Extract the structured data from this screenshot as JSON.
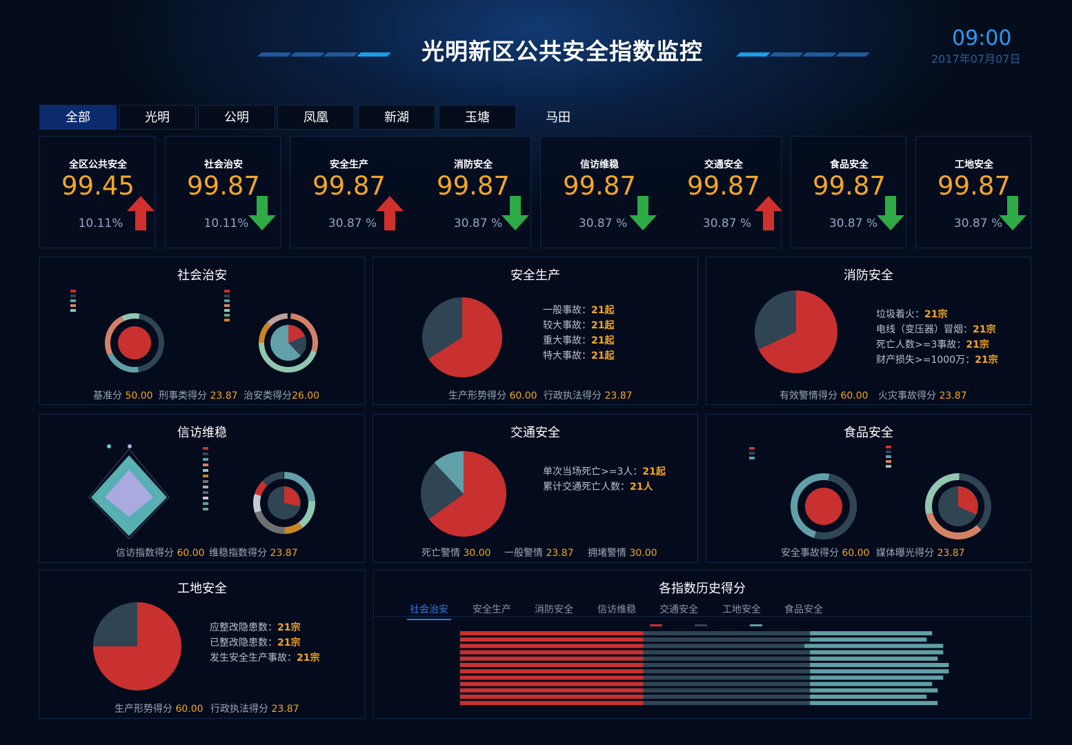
{
  "header": {
    "title": "光明新区公共安全指数监控",
    "time": "09:00",
    "date": "2017年07月07日"
  },
  "tabs": [
    "全部",
    "光明",
    "公明",
    "凤凰",
    "新湖",
    "玉塘",
    "马田"
  ],
  "kpis": [
    {
      "label": "全区公共安全",
      "value": "99.45",
      "pct": "10.11%",
      "trend": "up"
    },
    {
      "label": "社会治安",
      "value": "99.87",
      "pct": "10.11%",
      "trend": "down"
    },
    {
      "label": "安全生产",
      "value": "99.87",
      "pct": "30.87 %",
      "trend": "up"
    },
    {
      "label": "消防安全",
      "value": "99.87",
      "pct": "30.87 %",
      "trend": "down"
    },
    {
      "label": "信访维稳",
      "value": "99.87",
      "pct": "30.87 %",
      "trend": "down"
    },
    {
      "label": "交通安全",
      "value": "99.87",
      "pct": "30.87 %",
      "trend": "up"
    },
    {
      "label": "食品安全",
      "value": "99.87",
      "pct": "30.87 %",
      "trend": "down"
    },
    {
      "label": "工地安全",
      "value": "99.87",
      "pct": "30.87 %",
      "trend": "down"
    }
  ],
  "colors": {
    "red": "#c8312f",
    "slate": "#2f4554",
    "teal": "#61a0a8",
    "orange": "#d48265",
    "green": "#91c7ae",
    "gold": "#ca8622",
    "kpi_value": "#f5a623",
    "up": "#d0312d",
    "down": "#2eaa46"
  },
  "panels": {
    "shehui": {
      "title": "社会治安",
      "stats": [
        {
          "label": "基准分",
          "value": "50.00"
        },
        {
          "label": "刑事类得分",
          "value": "23.87"
        },
        {
          "label": "治安类得分",
          "value": "26.00"
        }
      ]
    },
    "anquan": {
      "title": "安全生产",
      "lines": [
        {
          "label": "一般事故：",
          "value": "21起"
        },
        {
          "label": "较大事故：",
          "value": "21起"
        },
        {
          "label": "重大事故：",
          "value": "21起"
        },
        {
          "label": "特大事故：",
          "value": "21起"
        }
      ],
      "stats": [
        {
          "label": "生产形势得分",
          "value": "60.00"
        },
        {
          "label": "行政执法得分",
          "value": "23.87"
        }
      ]
    },
    "xiaofang": {
      "title": "消防安全",
      "lines": [
        {
          "label": "垃圾着火：",
          "value": "21宗"
        },
        {
          "label": "电线（变压器）冒烟：",
          "value": "21宗"
        },
        {
          "label": "死亡人数>=3事故：",
          "value": "21宗"
        },
        {
          "label": "财产损失>=1000万：",
          "value": "21宗"
        }
      ],
      "stats": [
        {
          "label": "有效警情得分",
          "value": "60.00"
        },
        {
          "label": "火灾事故得分",
          "value": "23.87"
        }
      ]
    },
    "xinfang": {
      "title": "信访维稳",
      "stats": [
        {
          "label": "信访指数得分",
          "value": "60.00"
        },
        {
          "label": "维稳指数得分",
          "value": "23.87"
        }
      ]
    },
    "jiaotong": {
      "title": "交通安全",
      "lines": [
        {
          "label": "单次当场死亡>=3人：",
          "value": "21起"
        },
        {
          "label": "累计交通死亡人数：",
          "value": "21人"
        }
      ],
      "stats": [
        {
          "label": "死亡警情",
          "value": "30.00"
        },
        {
          "label": "一般警情",
          "value": "23.87"
        },
        {
          "label": "拥堵警情",
          "value": "30.00"
        }
      ]
    },
    "shipin": {
      "title": "食品安全",
      "stats": [
        {
          "label": "安全事故得分",
          "value": "60.00"
        },
        {
          "label": "媒体曝光得分",
          "value": "23.87"
        }
      ]
    },
    "gongdi": {
      "title": "工地安全",
      "lines": [
        {
          "label": "应整改隐患数：",
          "value": "21宗"
        },
        {
          "label": "已整改隐患数：",
          "value": "21宗"
        },
        {
          "label": "发生安全生产事故：",
          "value": "21宗"
        }
      ],
      "stats": [
        {
          "label": "生产形势得分",
          "value": "60.00"
        },
        {
          "label": "行政执法得分",
          "value": "23.87"
        }
      ]
    },
    "history": {
      "title": "各指数历史得分",
      "tabs": [
        "社会治安",
        "安全生产",
        "消防安全",
        "信访维稳",
        "交通安全",
        "工地安全",
        "食品安全"
      ]
    }
  },
  "chart_data": [
    {
      "type": "pie",
      "panel": "安全生产",
      "slices": [
        {
          "value": 66
        },
        {
          "value": 34
        }
      ]
    },
    {
      "type": "pie",
      "panel": "消防安全",
      "slices": [
        {
          "value": 68
        },
        {
          "value": 32
        }
      ]
    },
    {
      "type": "pie",
      "panel": "交通安全",
      "slices": [
        {
          "value": 65
        },
        {
          "value": 23
        },
        {
          "value": 12
        }
      ]
    },
    {
      "type": "pie",
      "panel": "工地安全",
      "slices": [
        {
          "value": 75
        },
        {
          "value": 25
        }
      ]
    },
    {
      "type": "bar",
      "panel": "各指数历史得分",
      "orientation": "horizontal",
      "stacked": true,
      "series": [
        {
          "values": [
            33,
            33,
            33,
            33,
            33,
            33,
            33,
            33,
            33,
            33,
            33,
            33
          ]
        },
        {
          "values": [
            30,
            30,
            29,
            30,
            30,
            30,
            30,
            30,
            30,
            30,
            30,
            30
          ]
        },
        {
          "values": [
            22,
            21,
            25,
            24,
            23,
            25,
            25,
            24,
            22,
            23,
            21,
            23
          ]
        }
      ]
    }
  ]
}
